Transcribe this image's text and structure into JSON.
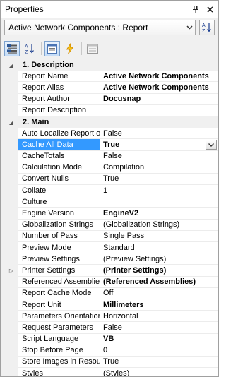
{
  "window": {
    "title": "Properties"
  },
  "object_selector": {
    "value": "Active Network Components : Report"
  },
  "grid": {
    "categories": [
      {
        "label": "1. Description",
        "expanded": true,
        "rows": [
          {
            "name": "Report Name",
            "value": "Active Network Components",
            "bold": true
          },
          {
            "name": "Report Alias",
            "value": "Active Network Components",
            "bold": true
          },
          {
            "name": "Report Author",
            "value": "Docusnap",
            "bold": true
          },
          {
            "name": "Report Description",
            "value": "",
            "bold": false
          }
        ]
      },
      {
        "label": "2. Main",
        "expanded": true,
        "rows": [
          {
            "name": "Auto Localize Report o",
            "value": "False",
            "bold": false
          },
          {
            "name": "Cache All Data",
            "value": "True",
            "bold": true,
            "selected": true,
            "dropdown": true
          },
          {
            "name": "CacheTotals",
            "value": "False",
            "bold": false
          },
          {
            "name": "Calculation Mode",
            "value": "Compilation",
            "bold": false
          },
          {
            "name": "Convert Nulls",
            "value": "True",
            "bold": false
          },
          {
            "name": "Collate",
            "value": "1",
            "bold": false
          },
          {
            "name": "Culture",
            "value": "",
            "bold": false
          },
          {
            "name": "Engine Version",
            "value": "EngineV2",
            "bold": true
          },
          {
            "name": "Globalization Strings",
            "value": "(Globalization Strings)",
            "bold": false
          },
          {
            "name": "Number of Pass",
            "value": "Single Pass",
            "bold": false
          },
          {
            "name": "Preview Mode",
            "value": "Standard",
            "bold": false
          },
          {
            "name": "Preview Settings",
            "value": "(Preview Settings)",
            "bold": false
          },
          {
            "name": "Printer Settings",
            "value": "(Printer Settings)",
            "bold": true,
            "expandable": true
          },
          {
            "name": "Referenced Assemblie",
            "value": "(Referenced Assemblies)",
            "bold": true
          },
          {
            "name": "Report Cache Mode",
            "value": "Off",
            "bold": false
          },
          {
            "name": "Report Unit",
            "value": "Millimeters",
            "bold": true
          },
          {
            "name": "Parameters Orientation",
            "value": "Horizontal",
            "bold": false
          },
          {
            "name": "Request Parameters",
            "value": "False",
            "bold": false
          },
          {
            "name": "Script Language",
            "value": "VB",
            "bold": true
          },
          {
            "name": "Stop Before Page",
            "value": "0",
            "bold": false
          },
          {
            "name": "Store Images in Resour",
            "value": "True",
            "bold": false
          },
          {
            "name": "Styles",
            "value": "(Styles)",
            "bold": false
          }
        ]
      }
    ]
  }
}
